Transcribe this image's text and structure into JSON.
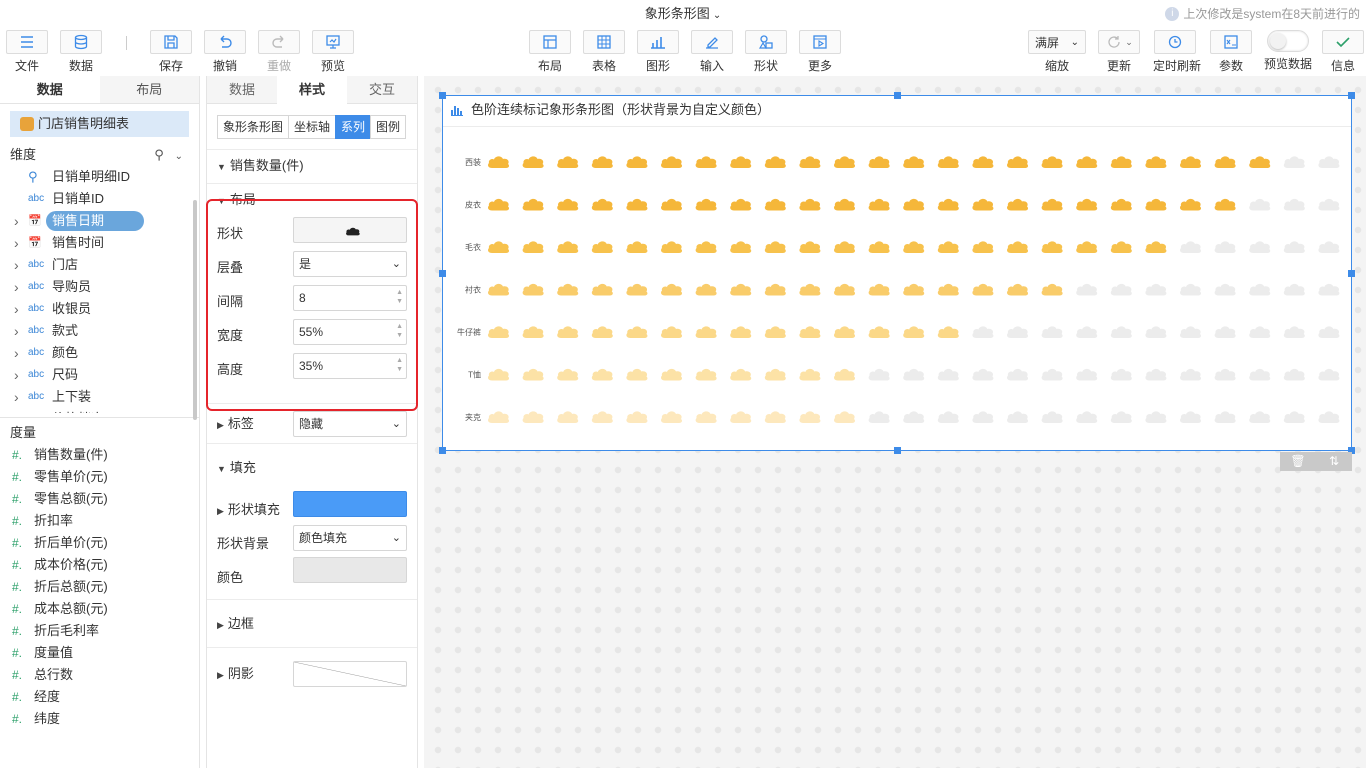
{
  "app": {
    "title": "象形条形图",
    "last_modified": "上次修改是system在8天前进行的"
  },
  "toolbar": {
    "left": [
      {
        "name": "file-button",
        "label": "文件"
      },
      {
        "name": "data-button",
        "label": "数据"
      },
      {
        "name": "save-button",
        "label": "保存"
      },
      {
        "name": "undo-button",
        "label": "撤销"
      },
      {
        "name": "redo-button",
        "label": "重做"
      },
      {
        "name": "preview-button",
        "label": "预览"
      }
    ],
    "center": [
      {
        "name": "layout-button",
        "label": "布局"
      },
      {
        "name": "table-button",
        "label": "表格"
      },
      {
        "name": "graph-button",
        "label": "图形"
      },
      {
        "name": "input-button",
        "label": "输入"
      },
      {
        "name": "shape-button",
        "label": "形状"
      },
      {
        "name": "more-button",
        "label": "更多"
      }
    ],
    "right": {
      "zoom_value": "满屏",
      "zoom_label": "缩放",
      "update_label": "更新",
      "timer_label": "定时刷新",
      "params_label": "参数",
      "preview_data_label": "预览数据",
      "info_label": "信息"
    }
  },
  "left_panel": {
    "tabs": [
      "数据",
      "布局"
    ],
    "dataset": "门店销售明细表",
    "dimensions_title": "维度",
    "dimensions": [
      {
        "type": "key",
        "name": "日销单明细ID"
      },
      {
        "type": "abc",
        "name": "日销单ID"
      },
      {
        "type": "date",
        "name": "销售日期",
        "selected": true
      },
      {
        "type": "date",
        "name": "销售时间"
      },
      {
        "type": "abc",
        "name": "门店"
      },
      {
        "type": "abc",
        "name": "导购员"
      },
      {
        "type": "abc",
        "name": "收银员"
      },
      {
        "type": "abc",
        "name": "款式"
      },
      {
        "type": "abc",
        "name": "颜色"
      },
      {
        "type": "abc",
        "name": "尺码"
      },
      {
        "type": "abc",
        "name": "上下装"
      },
      {
        "type": "abc",
        "name": "价格档次"
      }
    ],
    "measures_title": "度量",
    "measures": [
      "销售数量(件)",
      "零售单价(元)",
      "零售总额(元)",
      "折扣率",
      "折后单价(元)",
      "成本价格(元)",
      "折后总额(元)",
      "成本总额(元)",
      "折后毛利率",
      "度量值",
      "总行数",
      "经度",
      "纬度"
    ]
  },
  "mid_panel": {
    "tabs": [
      "数据",
      "样式",
      "交互"
    ],
    "subtabs": [
      "象形条形图",
      "坐标轴",
      "系列",
      "图例"
    ],
    "series_name": "销售数量(件)",
    "layout_group": "布局",
    "shape_label": "形状",
    "overlap_label": "层叠",
    "overlap_value": "是",
    "gap_label": "间隔",
    "gap_value": "8",
    "width_label": "宽度",
    "width_value": "55%",
    "height_label": "高度",
    "height_value": "35%",
    "tag_label": "标签",
    "tag_value": "隐藏",
    "fill_group": "填充",
    "shape_fill_label": "形状填充",
    "shape_fill_color": "#4a9bf7",
    "shape_bg_label": "形状背景",
    "shape_bg_value": "颜色填充",
    "color_label": "颜色",
    "border_group": "边框",
    "shadow_group": "阴影"
  },
  "chart": {
    "title": "色阶连续标记象形条形图（形状背景为自定义颜色）"
  },
  "chart_data": {
    "type": "bar",
    "symbol": "cloud",
    "categories": [
      "西装",
      "皮衣",
      "毛衣",
      "衬衣",
      "牛仔裤",
      "T恤",
      "夹克"
    ],
    "values": [
      23,
      22,
      20,
      17,
      14,
      11,
      11
    ],
    "max_symbols": 25,
    "colors": [
      "#f5b73a",
      "#f5b73a",
      "#f7c24d",
      "#f9cc6a",
      "#fbd888",
      "#fce2a6",
      "#fde8bd"
    ],
    "background_color": "#ececec"
  }
}
